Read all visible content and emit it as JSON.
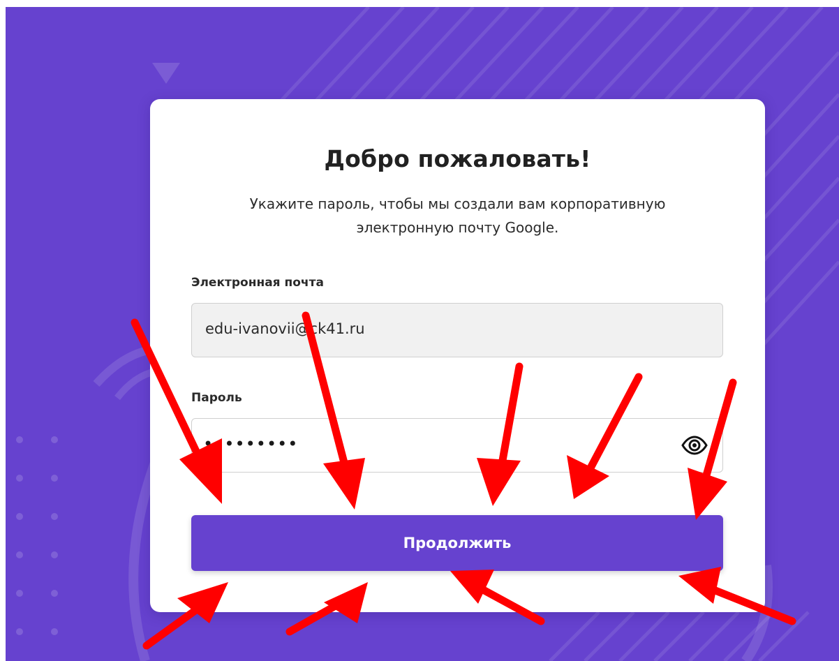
{
  "card": {
    "title": "Добро пожаловать!",
    "subtitle": "Укажите пароль, чтобы мы создали вам корпоративную электронную почту Google."
  },
  "form": {
    "email_label": "Электронная почта",
    "email_value": "edu-ivanovii@ck41.ru",
    "password_label": "Пароль",
    "password_mask": "•••••••••",
    "submit_label": "Продолжить"
  },
  "icons": {
    "password_toggle": "eye-icon",
    "annotation": "red-arrow-icon"
  },
  "colors": {
    "background": "#6642cf",
    "button": "#6642cf",
    "arrows": "#ff0000"
  }
}
